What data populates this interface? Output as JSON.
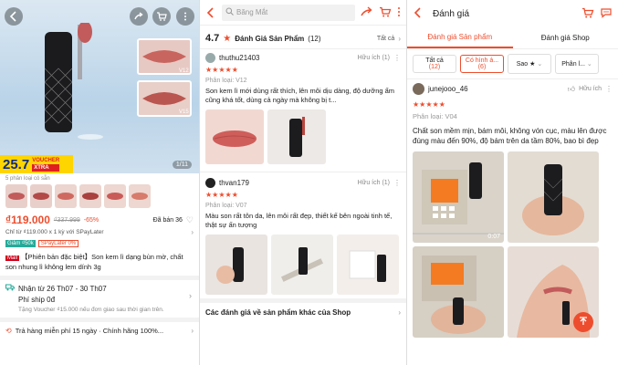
{
  "panel1": {
    "image_counter": "1/11",
    "voucher_price": "25.7",
    "voucher_label": "VOUCHER",
    "voucher_sub": "XTRA",
    "variant_count": "5 phân loại có sẵn",
    "zoom_tags": [
      "V12",
      "V15"
    ],
    "price": "₫119.000",
    "old_price": "₫337.999",
    "discount": "-65%",
    "sold": "Đã bán 36",
    "installment": "Chỉ từ ₫119.000 x 1 kỳ với SPayLater",
    "tags": [
      "Giảm ₫50k",
      "SPayLater 0%"
    ],
    "mall_badge": "Mall",
    "title": "【Phiên bản đặc biệt】Son kem lì dạng bùn mờ, chất son nhung lì không lem dính 3g",
    "shipping_date": "Nhận từ 26 Th07 - 30 Th07",
    "shipping_fee": "Phí ship 0đ",
    "shipping_note": "Tặng Voucher ₫15.000 nếu đơn giao sau thời gian trên.",
    "footer_policy": "Trả hàng miễn phí 15 ngày · Chính hãng 100%..."
  },
  "panel2": {
    "search_placeholder": "Băng Mắt",
    "rating": "4.7",
    "rating_title": "Đánh Giá Sản Phẩm",
    "rating_count": "(12)",
    "see_all": "Tất cả",
    "reviews": [
      {
        "user": "thuthu21403",
        "helpful": "Hữu ích (1)",
        "stars": "★★★★★",
        "variant": "Phân loại: V12",
        "text": "Son kem lì mới dùng rất thích, lên môi dịu dàng, độ dưỡng ẩm cũng khá tốt, dùng cả ngày mà không bị t..."
      },
      {
        "user": "thvan179",
        "helpful": "Hữu ích (1)",
        "stars": "★★★★★",
        "variant": "Phân loại: V07",
        "text": "Màu son rất tôn da, lên môi rất đẹp, thiết kế bên ngoài tinh tế, thật sự ấn tượng"
      }
    ],
    "other_reviews": "Các đánh giá về sản phẩm khác của Shop"
  },
  "panel3": {
    "title": "Đánh giá",
    "tabs": [
      "Đánh giá Sản phẩm",
      "Đánh giá Shop"
    ],
    "filters": [
      {
        "label": "Tất cả",
        "count": "(12)"
      },
      {
        "label": "Có hình ả...",
        "count": "(6)"
      },
      {
        "label": "Sao ★",
        "count": ""
      },
      {
        "label": "Phân l...",
        "count": ""
      }
    ],
    "user": "junejooo_46",
    "helpful": "Hữu ích",
    "stars": "★★★★★",
    "variant": "Phân loại: V04",
    "text": "Chất son mềm mịn, bám môi, không vón cục, màu lên được đúng màu đến 90%, độ bám trên da tầm 80%, bao bì đẹp",
    "video_time": "0:07"
  },
  "colors": {
    "accent": "#ee4d2d",
    "voucher_yellow": "#ffd500"
  }
}
